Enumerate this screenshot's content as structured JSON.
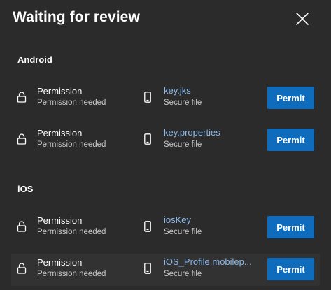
{
  "dialog": {
    "title": "Waiting for review",
    "close_icon": "close-icon"
  },
  "sections": [
    {
      "heading": "Android",
      "items": [
        {
          "permission_title": "Permission",
          "permission_status": "Permission needed",
          "resource_name": "key.jks",
          "resource_type": "Secure file",
          "action_label": "Permit"
        },
        {
          "permission_title": "Permission",
          "permission_status": "Permission needed",
          "resource_name": "key.properties",
          "resource_type": "Secure file",
          "action_label": "Permit"
        }
      ]
    },
    {
      "heading": "iOS",
      "items": [
        {
          "permission_title": "Permission",
          "permission_status": "Permission needed",
          "resource_name": "iosKey",
          "resource_type": "Secure file",
          "action_label": "Permit"
        },
        {
          "permission_title": "Permission",
          "permission_status": "Permission needed",
          "resource_name": "iOS_Profile.mobilep...",
          "resource_type": "Secure file",
          "action_label": "Permit"
        }
      ]
    }
  ],
  "colors": {
    "background": "#2b2b2b",
    "row_highlight": "#323232",
    "accent": "#0f6cbd",
    "link": "#8cb8ea",
    "secondary_text": "#c8c8c8"
  }
}
